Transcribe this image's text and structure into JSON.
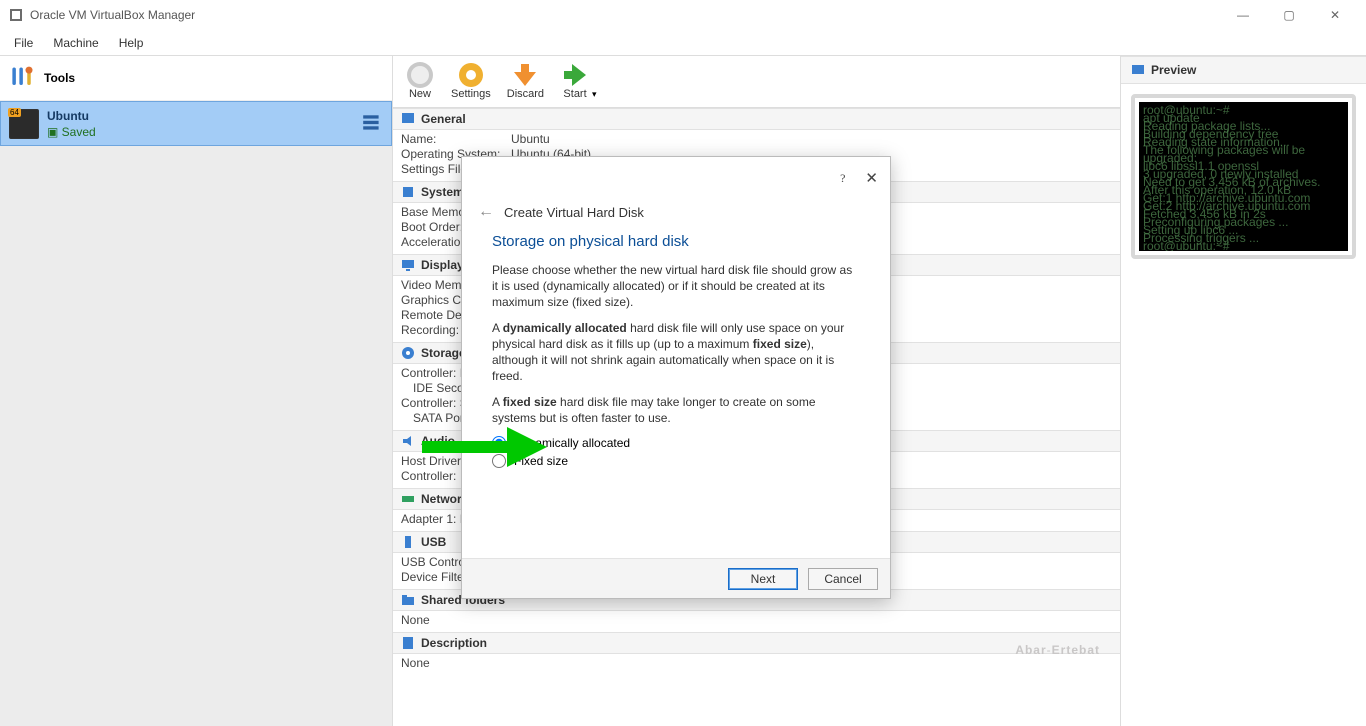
{
  "app_title": "Oracle VM VirtualBox Manager",
  "menu": {
    "file": "File",
    "machine": "Machine",
    "help": "Help"
  },
  "tools_label": "Tools",
  "vm": {
    "name": "Ubuntu",
    "state": "Saved"
  },
  "toolbar": {
    "new": "New",
    "settings": "Settings",
    "discard": "Discard",
    "start": "Start"
  },
  "details": {
    "general": {
      "title": "General",
      "name_k": "Name:",
      "name_v": "Ubuntu",
      "os_k": "Operating System:",
      "os_v": "Ubuntu (64-bit)",
      "loc_k": "Settings File Lo"
    },
    "system": {
      "title": "System",
      "mem_k": "Base Memory:",
      "boot_k": "Boot Order:",
      "accel_k": "Acceleration:"
    },
    "display": {
      "title": "Display",
      "vmem_k": "Video Memory",
      "ctrl_k": "Graphics Cont",
      "rdp_k": "Remote Deskt",
      "rec_k": "Recording:"
    },
    "storage": {
      "title": "Storage",
      "c1": "Controller: IDE",
      "c2": "IDE Seconda",
      "c3": "Controller: SA",
      "c4": "SATA Port 0:"
    },
    "audio": {
      "title": "Audio",
      "hd_k": "Host Driver:",
      "ctrl_k": "Controller:"
    },
    "network": {
      "title": "Network",
      "adp": "Adapter 1:  I"
    },
    "usb": {
      "title": "USB",
      "c1": "USB Controller",
      "c2": "Device Filters:"
    },
    "shared": {
      "title": "Shared folders",
      "none": "None"
    },
    "description": {
      "title": "Description",
      "none": "None"
    }
  },
  "preview": {
    "title": "Preview"
  },
  "dialog": {
    "breadcrumb": "Create Virtual Hard Disk",
    "heading": "Storage on physical hard disk",
    "p1": "Please choose whether the new virtual hard disk file should grow as it is used (dynamically allocated) or if it should be created at its maximum size (fixed size).",
    "p2a": "A ",
    "p2b": "dynamically allocated",
    "p2c": " hard disk file will only use space on your physical hard disk as it fills up (up to a maximum ",
    "p2d": "fixed size",
    "p2e": "), although it will not shrink again automatically when space on it is freed.",
    "p3a": "A ",
    "p3b": "fixed size",
    "p3c": " hard disk file may take longer to create on some systems but is often faster to use.",
    "opt_dynamic": "Dynamically allocated",
    "opt_fixed": "Fixed size",
    "btn_next": "Next",
    "btn_cancel": "Cancel"
  },
  "watermark": {
    "a": "Abar",
    "sep": "-",
    "b": "Ertebat"
  }
}
